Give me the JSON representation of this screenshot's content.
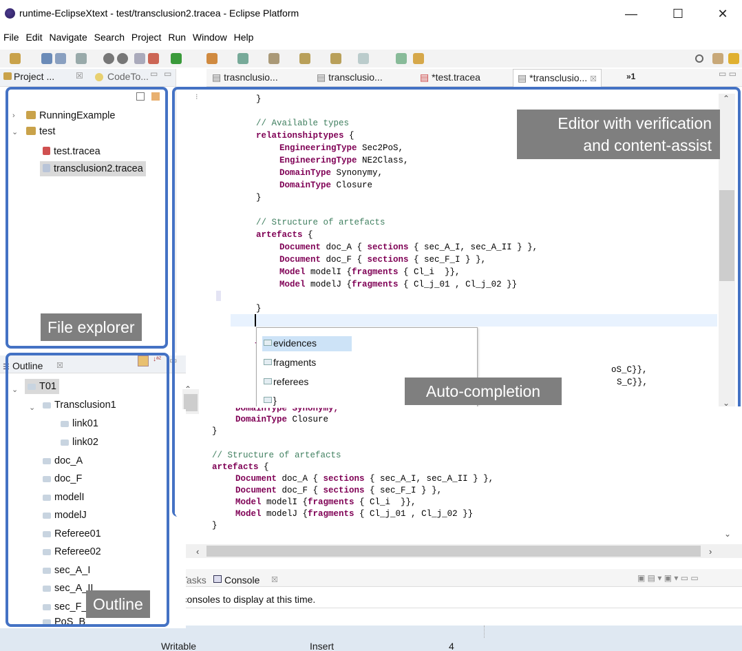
{
  "window": {
    "title": "runtime-EclipseXtext - test/transclusion2.tracea - Eclipse Platform",
    "minimize": "—",
    "maximize": "☐",
    "close": "✕"
  },
  "menu": [
    "File",
    "Edit",
    "Navigate",
    "Search",
    "Project",
    "Run",
    "Window",
    "Help"
  ],
  "left_tabs": {
    "project": "Project ...",
    "codeto": "CodeTo..."
  },
  "explorer": {
    "items": [
      {
        "label": "RunningExample"
      },
      {
        "label": "test"
      },
      {
        "label": "test.tracea"
      },
      {
        "label": "transclusion2.tracea"
      }
    ]
  },
  "editor_tabs": [
    {
      "label": "trasnclusio..."
    },
    {
      "label": "transclusio..."
    },
    {
      "label": "*test.tracea"
    },
    {
      "label": "*transclusio..."
    }
  ],
  "editor_tabs_more": "»1",
  "code": {
    "brace_close": "}",
    "comment_types": "// Available types",
    "rel_kw": "relationshiptypes",
    "rel_open": " {",
    "eng_kw": "EngineeringType",
    "eng1": " Sec2PoS,",
    "eng2": " NE2Class,",
    "dom_kw": "DomainType",
    "dom1": " Synonymy,",
    "dom2": " Closure",
    "comment_art": "// Structure of artefacts",
    "art_kw": "artefacts",
    "art_open": " {",
    "doc_kw": "Document",
    "sections_kw": "sections",
    "model_kw": "Model",
    "fragments_kw": "fragments",
    "docA_1": " doc_A { ",
    "docA_2": " { sec_A_I, sec_A_II } },",
    "docF_1": " doc_F { ",
    "docF_2": " { sec_F_I } },",
    "modelI_1": " modelI {",
    "modelI_2": " { Cl_i  }},",
    "modelJ_1": " modelJ {",
    "modelJ_2": " { Cl_j_01 , Cl_j_02 }}",
    "partial_comment": "/",
    "partial_f": "f",
    "right_frag1": "oS_C}},",
    "right_frag2": "S_C}},",
    "overlap_line": "DomainType Synonymy,"
  },
  "assist": {
    "items": [
      "evidences",
      "fragments",
      "referees",
      "}"
    ]
  },
  "outline": {
    "tab_label": "Outline",
    "items": [
      "T01",
      "Transclusion1",
      "link01",
      "link02",
      "doc_A",
      "doc_F",
      "modelI",
      "modelJ",
      "Referee01",
      "Referee02",
      "sec_A_I",
      "sec_A_II",
      "sec_F_I",
      "PoS_B"
    ]
  },
  "bottom_tabs": {
    "tasks": "Tasks",
    "console": "Console"
  },
  "console_message": "› consoles to display at this time.",
  "status": {
    "writable": "Writable",
    "insert": "Insert",
    "position": "4"
  },
  "callouts": {
    "editor": "Editor with verification and content-assist",
    "editor_line1": "Editor with verification",
    "editor_line2": "and content-assist",
    "explorer": "File explorer",
    "autocompletion": "Auto-completion",
    "outline": "Outline"
  },
  "colors": {
    "accent_box": "#4472c4",
    "callout_bg": "#7f7f7f",
    "keyword": "#7f0055",
    "comment": "#3f7f5f"
  }
}
